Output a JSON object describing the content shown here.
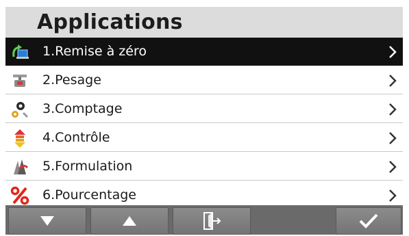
{
  "header": {
    "title": "Applications"
  },
  "menu": {
    "items": [
      {
        "label": "1.Remise à zéro",
        "icon": "reset-zero-icon",
        "selected": true
      },
      {
        "label": "2.Pesage",
        "icon": "weighing-scale-icon",
        "selected": false
      },
      {
        "label": "3.Comptage",
        "icon": "parts-counting-icon",
        "selected": false
      },
      {
        "label": "4.Contrôle",
        "icon": "check-weighing-icon",
        "selected": false
      },
      {
        "label": "5.Formulation",
        "icon": "formulation-icon",
        "selected": false
      },
      {
        "label": "6.Pourcentage",
        "icon": "percent-icon",
        "selected": false
      }
    ]
  },
  "toolbar": {
    "buttons": [
      {
        "name": "down",
        "icon": "arrow-down-icon"
      },
      {
        "name": "up",
        "icon": "arrow-up-icon"
      },
      {
        "name": "exit",
        "icon": "exit-door-icon"
      },
      {
        "name": "confirm",
        "icon": "checkmark-icon"
      }
    ]
  },
  "colors": {
    "header_bg": "#dcdcdc",
    "selected_bg": "#111111",
    "toolbar_bg": "#6a6a6a",
    "percent_red": "#e0261b"
  }
}
